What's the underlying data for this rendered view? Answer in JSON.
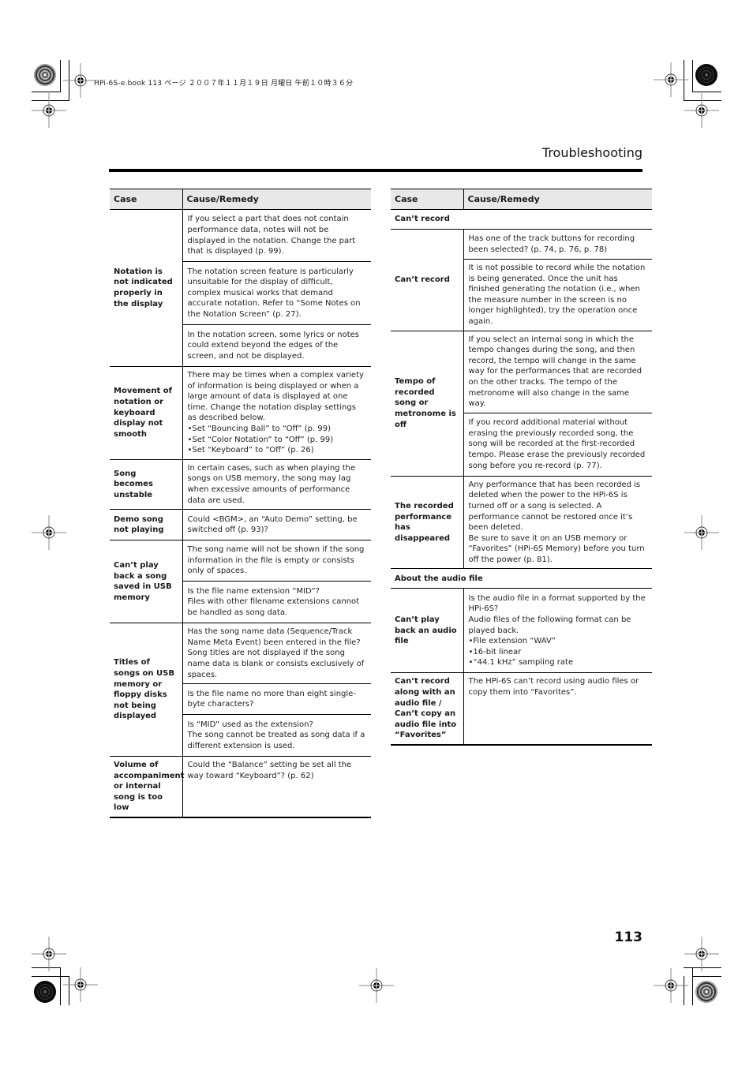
{
  "print_header": "HPi-6S-e.book  113 ページ  ２００７年１１月１９日  月曜日  午前１０時３６分",
  "section_title": "Troubleshooting",
  "page_number": "113",
  "left_table": {
    "headers": [
      "Case",
      "Cause/Remedy"
    ],
    "rows": [
      {
        "case": "Notation is not indicated properly in the display",
        "remedies": [
          "If you select a part that does not contain performance data, notes will not be displayed in the notation. Change the part that is displayed (p. 99).",
          "The notation screen feature is particularly unsuitable for the display of difficult, complex musical works that demand accurate notation. Refer to “Some Notes on the Notation Screen” (p. 27).",
          "In the notation screen, some lyrics or notes could extend beyond the edges of the screen, and not be displayed."
        ]
      },
      {
        "case": "Movement of notation or keyboard display not smooth",
        "remedies": [
          "There may be times when a complex variety of information is being displayed or when a large amount of data is displayed at one time. Change the notation display settings as described below.\n•Set “Bouncing Ball” to “Off” (p. 99)\n•Set “Color Notation” to “Off” (p. 99)\n•Set “Keyboard” to “Off” (p. 26)"
        ]
      },
      {
        "case": "Song becomes unstable",
        "remedies": [
          "In certain cases, such as when playing the songs on USB memory, the song may lag when excessive amounts of performance data are used."
        ]
      },
      {
        "case": "Demo song not playing",
        "remedies": [
          "Could <BGM>, an “Auto Demo” setting, be switched off (p. 93)?"
        ]
      },
      {
        "case": "Can’t play back a song saved in USB memory",
        "remedies": [
          "The song name will not be shown if the song information in the file is empty or consists only of spaces.",
          "Is the file name extension “MID”?\nFiles with other filename extensions cannot be handled as song data."
        ]
      },
      {
        "case": "Titles of songs on USB memory or floppy disks not being displayed",
        "remedies": [
          "Has the song name data (Sequence/Track Name Meta Event) been entered in the file?\nSong titles are not displayed if the song name data is blank or consists exclusively of spaces.",
          "Is the file name no more than eight single-byte characters?",
          "Is “MID” used as the extension?\nThe song cannot be treated as song data if a different extension is used."
        ]
      },
      {
        "case": "Volume of accompaniment or internal song is too low",
        "remedies": [
          "Could the “Balance” setting be set all the way toward “Keyboard”? (p. 62)"
        ]
      }
    ]
  },
  "right_table": {
    "headers": [
      "Case",
      "Cause/Remedy"
    ],
    "groups": [
      {
        "title": "Can’t record",
        "rows": [
          {
            "case": "Can’t record",
            "remedies": [
              "Has one of the track buttons for recording been selected? (p. 74, p. 76, p. 78)",
              "It is not possible to record while the notation is being generated. Once the unit has finished generating the notation (i.e., when the measure number in the screen is no longer highlighted), try the operation once again."
            ]
          },
          {
            "case": "Tempo of recorded song or metronome is off",
            "remedies": [
              "If you select an internal song in which the tempo changes during the song, and then record, the tempo will change in the same way for the performances that are recorded on the other tracks. The tempo of the metronome will also change in the same way.",
              "If you record additional material without erasing the previously recorded song, the song will be recorded at the first-recorded tempo. Please erase the previously recorded song before you re-record (p. 77)."
            ]
          },
          {
            "case": "The recorded performance has disappeared",
            "remedies": [
              "Any performance that has been recorded is deleted when the power to the HPi-6S is turned off or a song is selected. A performance cannot be restored once it’s been deleted.\nBe sure to save it on an USB memory or “Favorites” (HPi-6S Memory) before you turn off the power (p. 81)."
            ]
          }
        ]
      },
      {
        "title": "About the audio file",
        "rows": [
          {
            "case": "Can’t play back an audio file",
            "remedies": [
              "Is the audio file in a format supported by the HPi-6S?\nAudio files of the following format can be played back.\n•File extension “WAV”\n•16-bit linear\n•“44.1 kHz” sampling rate"
            ]
          },
          {
            "case": "Can’t record along with an audio file / Can’t copy an audio file into “Favorites”",
            "remedies": [
              "The HPi-6S can’t record using audio files or copy them into “Favorites”."
            ]
          }
        ]
      }
    ]
  }
}
